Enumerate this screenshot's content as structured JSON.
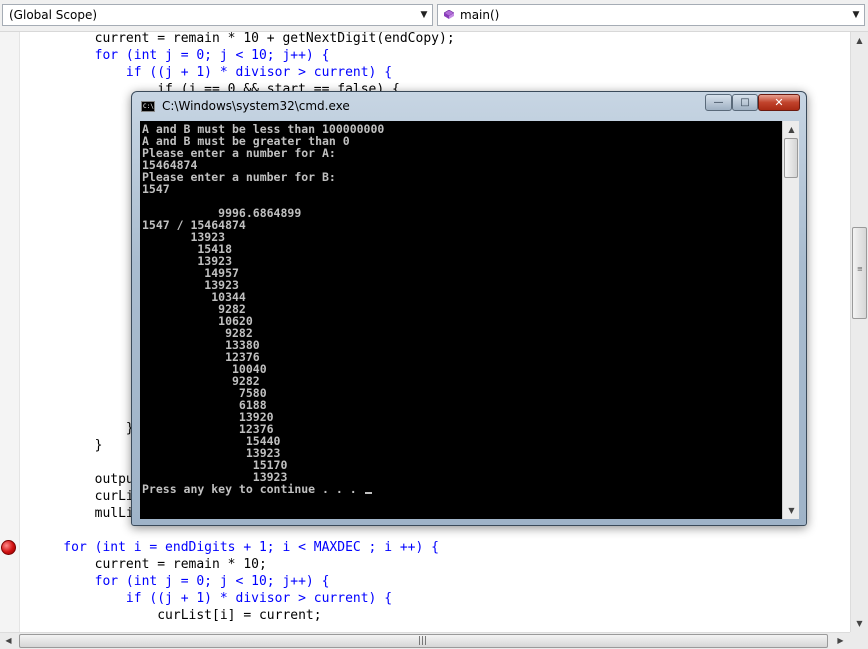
{
  "toolbar": {
    "scope_combo": "(Global Scope)",
    "function_combo": "main()"
  },
  "editor": {
    "lines": [
      "        current = remain * 10 + getNextDigit(endCopy);",
      "        for (int j = 0; j < 10; j++) {",
      "            if ((j + 1) * divisor > current) {",
      "                if (j == 0 && start == false) {",
      "            }",
      "        }",
      "        outpu",
      "        curLi",
      "        mulLi",
      "    for (int i = endDigits + 1; i < MAXDEC ; i ++) {",
      "        current = remain * 10;",
      "        for (int j = 0; j < 10; j++) {",
      "            if ((j + 1) * divisor > current) {",
      "                curList[i] = current;"
    ]
  },
  "console": {
    "title": "C:\\Windows\\system32\\cmd.exe",
    "buttons": {
      "minimize": "—",
      "maximize": "□",
      "close": "✕"
    },
    "lines": [
      "A and B must be less than 100000000",
      "A and B must be greater than 0",
      "Please enter a number for A:",
      "15464874",
      "Please enter a number for B:",
      "1547",
      "",
      "           9996.6864899",
      "1547 / 15464874",
      "       13923",
      "        15418",
      "        13923",
      "         14957",
      "         13923",
      "          10344",
      "           9282",
      "           10620",
      "            9282",
      "            13380",
      "            12376",
      "             10040",
      "             9282",
      "              7580",
      "              6188",
      "              13920",
      "              12376",
      "               15440",
      "               13923",
      "                15170",
      "                13923",
      "Press any key to continue . . . "
    ]
  }
}
